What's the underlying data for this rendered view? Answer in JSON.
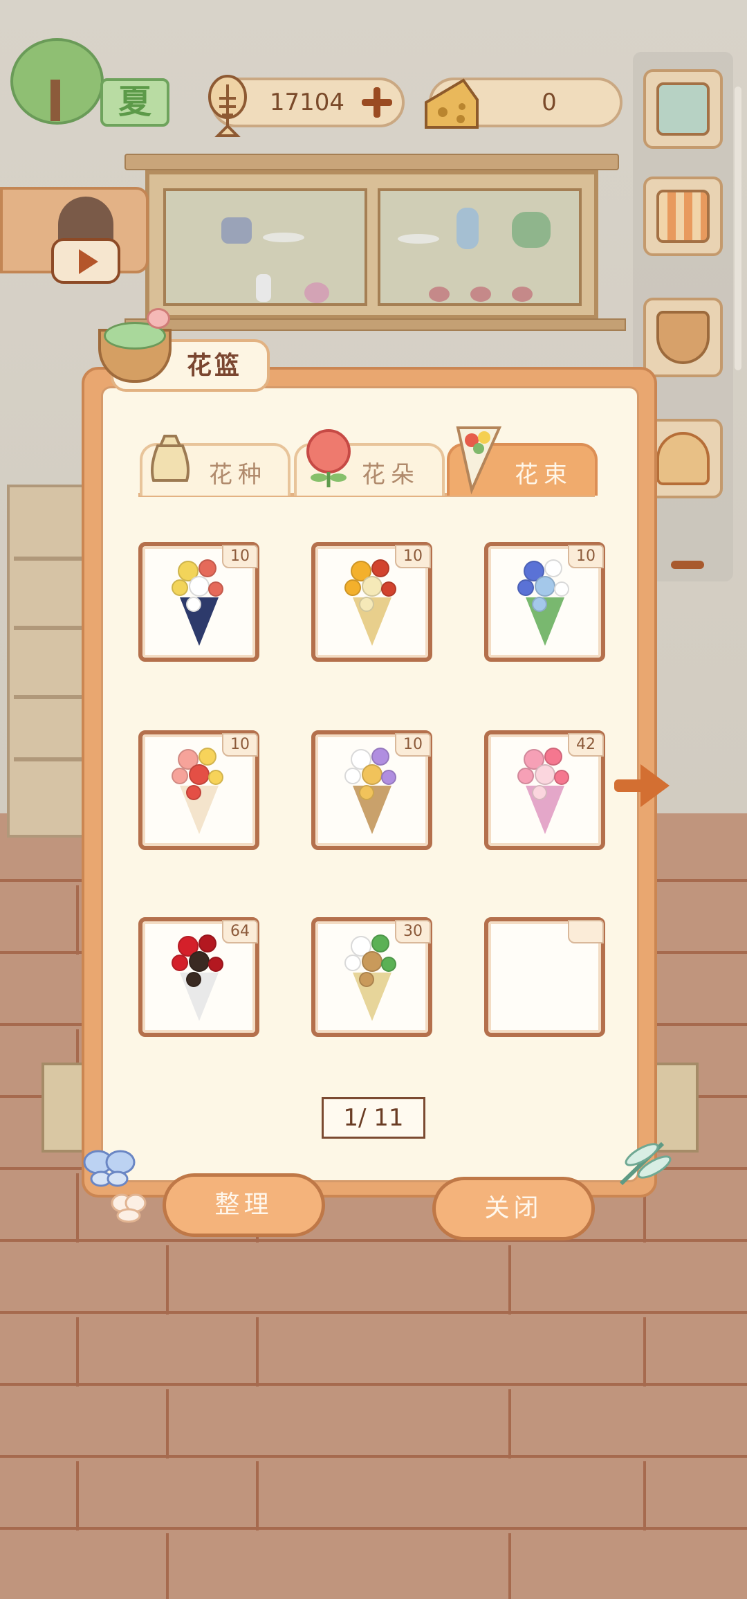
{
  "season": "夏",
  "currency": {
    "fish_value": "17104",
    "cheese_value": "0"
  },
  "panel": {
    "title": "花篮",
    "tabs": [
      {
        "label": "花种",
        "active": false
      },
      {
        "label": "花朵",
        "active": false
      },
      {
        "label": "花束",
        "active": true
      }
    ],
    "items": [
      {
        "count": "10",
        "colors": [
          "#f2d45a",
          "#e56a5a",
          "#ffffff",
          "#2d3a6b"
        ]
      },
      {
        "count": "10",
        "colors": [
          "#f3b02c",
          "#d2432e",
          "#f5e9b8",
          "#e8cf8c"
        ]
      },
      {
        "count": "10",
        "colors": [
          "#5a72d6",
          "#ffffff",
          "#a4c8ea",
          "#79b86f"
        ]
      },
      {
        "count": "10",
        "colors": [
          "#f6a39a",
          "#f7d35a",
          "#e44f45",
          "#f4e4cc"
        ]
      },
      {
        "count": "10",
        "colors": [
          "#ffffff",
          "#b08ee0",
          "#f1c35b",
          "#c9a16b"
        ]
      },
      {
        "count": "42",
        "colors": [
          "#f6a0b6",
          "#f5778f",
          "#fbd6de",
          "#e4a7c9"
        ]
      },
      {
        "count": "64",
        "colors": [
          "#d4202a",
          "#b31820",
          "#3a2a22",
          "#e9e9e9"
        ]
      },
      {
        "count": "30",
        "colors": [
          "#ffffff",
          "#5bb155",
          "#c99a5b",
          "#e7d59a"
        ]
      },
      {
        "count": "",
        "colors": []
      }
    ],
    "pagination": "1/ 11",
    "sort_button": "整理",
    "close_button": "关闭"
  }
}
